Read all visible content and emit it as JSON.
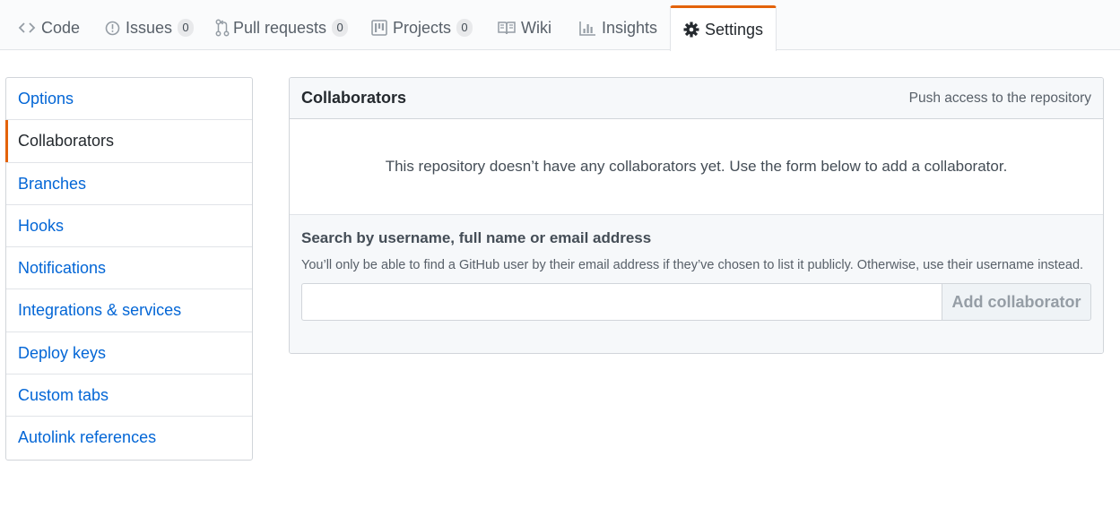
{
  "tabs": [
    {
      "label": "Code",
      "icon": "code-icon"
    },
    {
      "label": "Issues",
      "icon": "issue-icon",
      "count": "0"
    },
    {
      "label": "Pull requests",
      "icon": "pull-request-icon",
      "count": "0"
    },
    {
      "label": "Projects",
      "icon": "project-icon",
      "count": "0"
    },
    {
      "label": "Wiki",
      "icon": "book-icon"
    },
    {
      "label": "Insights",
      "icon": "graph-icon"
    },
    {
      "label": "Settings",
      "icon": "gear-icon",
      "selected": true
    }
  ],
  "menu": {
    "items": [
      {
        "label": "Options"
      },
      {
        "label": "Collaborators",
        "selected": true
      },
      {
        "label": "Branches"
      },
      {
        "label": "Hooks"
      },
      {
        "label": "Notifications"
      },
      {
        "label": "Integrations & services"
      },
      {
        "label": "Deploy keys"
      },
      {
        "label": "Custom tabs"
      },
      {
        "label": "Autolink references"
      }
    ]
  },
  "collaborators": {
    "title": "Collaborators",
    "note": "Push access to the repository",
    "empty_message": "This repository doesn’t have any collaborators yet. Use the form below to add a collaborator.",
    "search_label": "Search by username, full name or email address",
    "search_note": "You’ll only be able to find a GitHub user by their email address if they’ve chosen to list it publicly. Otherwise, use their username instead.",
    "search_value": "",
    "add_button": "Add collaborator"
  },
  "colors": {
    "accent": "#e36209",
    "link": "#0366d6",
    "text": "#24292e",
    "muted": "#586069",
    "border": "#d1d5da"
  }
}
